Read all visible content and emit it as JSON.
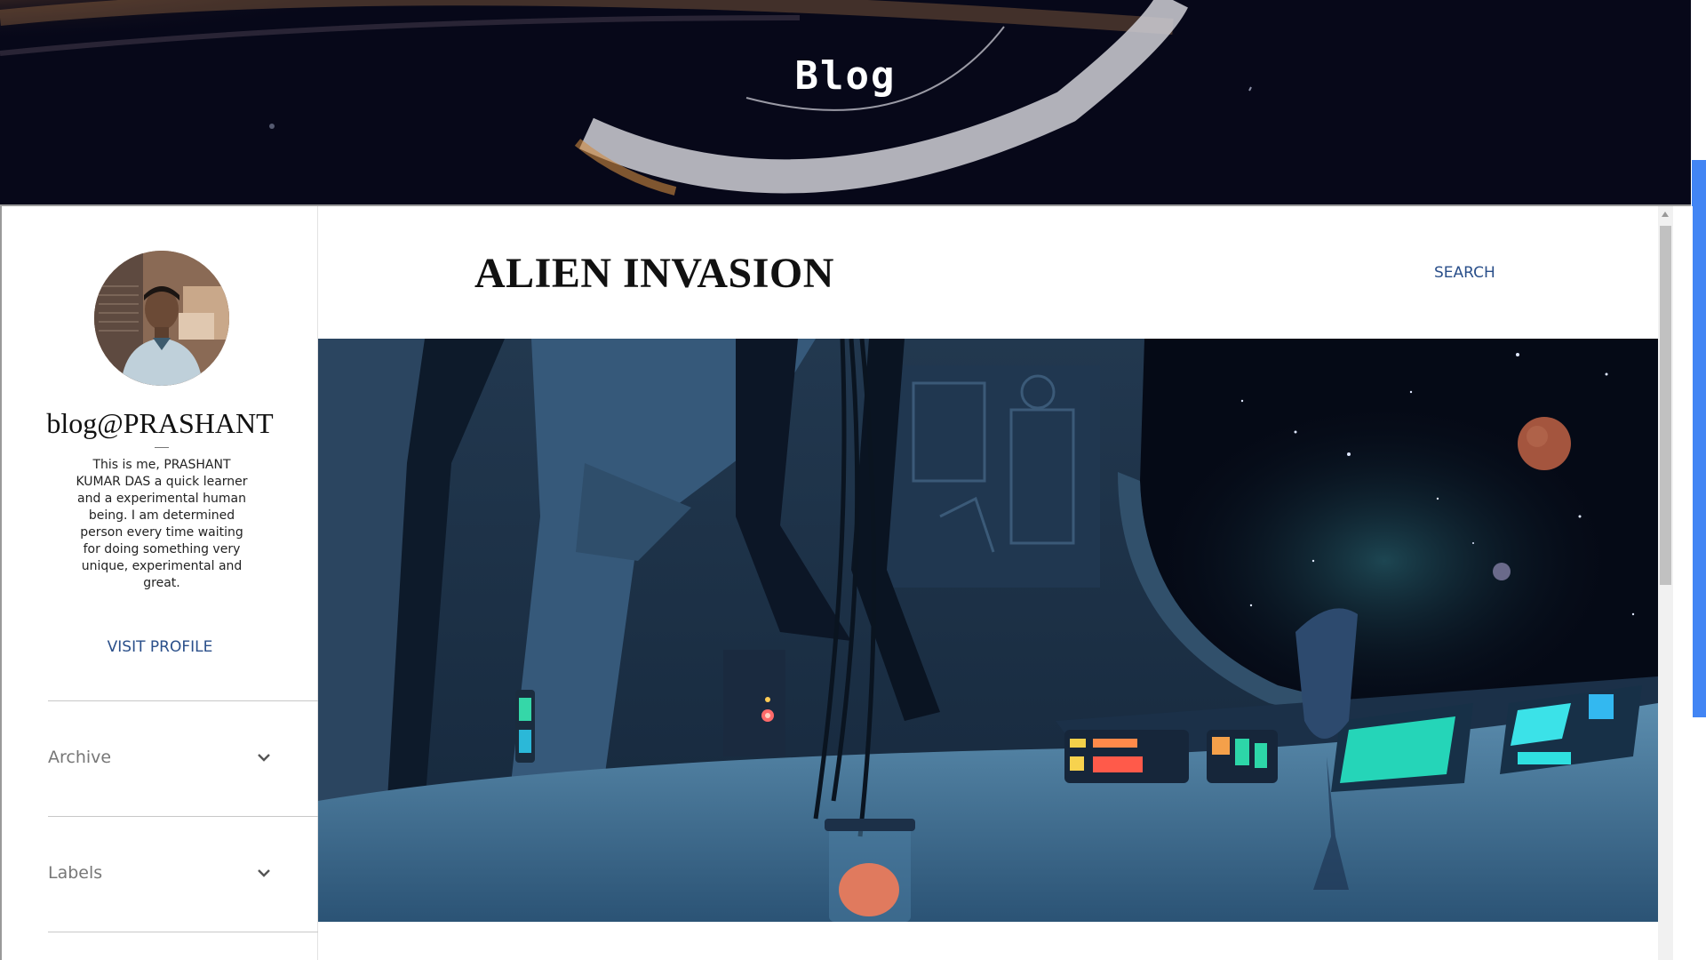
{
  "header": {
    "title": "Blog"
  },
  "sidebar": {
    "blog_name": "blog@PRASHANT",
    "about_text": "This is me, PRASHANT KUMAR DAS a quick learner and a experimental human being. I am determined person every time waiting for doing something very unique, experimental and great.",
    "visit_profile": "VISIT PROFILE",
    "sections": [
      {
        "label": "Archive",
        "icon": "chevron-down-icon"
      },
      {
        "label": "Labels",
        "icon": "chevron-down-icon"
      }
    ]
  },
  "post": {
    "title": "ALIEN INVASION"
  },
  "nav": {
    "search_label": "SEARCH"
  },
  "colors": {
    "link": "#2a4f8a",
    "scroll_accent": "#4285f4"
  }
}
